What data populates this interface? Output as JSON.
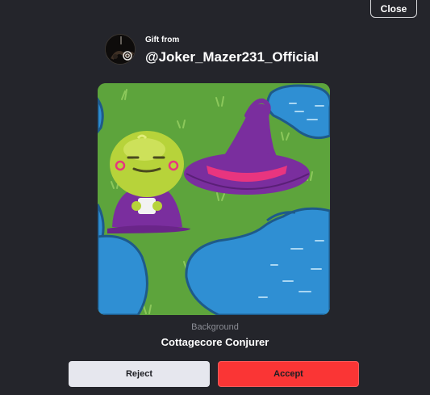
{
  "close_label": "Close",
  "gift": {
    "from_label": "Gift from",
    "username": "@Joker_Mazer231_Official"
  },
  "item": {
    "type": "Background",
    "name": "Cottagecore Conjurer",
    "art_icon": "cottagecore-conjurer-background"
  },
  "actions": {
    "reject_label": "Reject",
    "accept_label": "Accept"
  },
  "colors": {
    "background": "#24252b",
    "accept": "#fa3535",
    "reject": "#e6e7ee",
    "grass": "#5da43c",
    "water": "#2f8fd3",
    "hat": "#7a2e9e",
    "hat_band": "#e8357f",
    "character": "#b7d33a"
  }
}
